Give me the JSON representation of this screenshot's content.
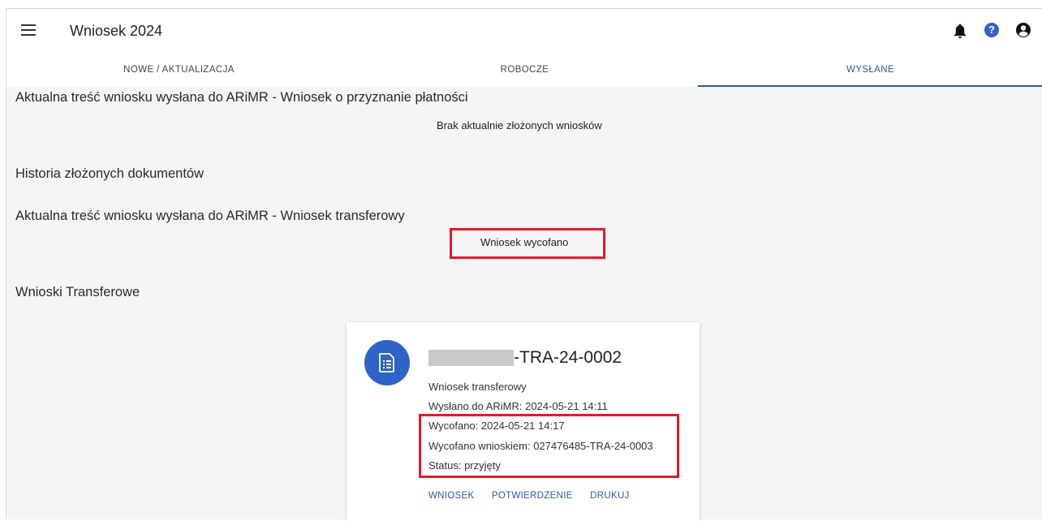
{
  "header": {
    "title": "Wniosek 2024",
    "icons": [
      "menu-icon",
      "bell-icon",
      "help-icon",
      "account-icon"
    ]
  },
  "tabs": [
    {
      "label": "NOWE / AKTUALIZACJA",
      "active": false
    },
    {
      "label": "ROBOCZE",
      "active": false
    },
    {
      "label": "WYSŁANE",
      "active": true
    }
  ],
  "sections": {
    "current_payment_title": "Aktualna treść wniosku wysłana do ARiMR - Wniosek o przyznanie płatności",
    "no_applications": "Brak aktualnie złożonych wniosków",
    "history_title": "Historia złożonych dokumentów",
    "current_transfer_title": "Aktualna treść wniosku wysłana do ARiMR - Wniosek transferowy",
    "withdrawn_text": "Wniosek wycofano",
    "transfer_list_title": "Wnioski Transferowe"
  },
  "card": {
    "number_suffix": "-TRA-24-0002",
    "type": "Wniosek transferowy",
    "sent": "Wysłano do ARiMR: 2024-05-21 14:11",
    "withdrawn": "Wycofano: 2024-05-21 14:17",
    "withdrawn_by": "Wycofano wnioskiem: 027476485-TRA-24-0003",
    "status": "Status: przyjęty",
    "actions": [
      "WNIOSEK",
      "POTWIERDZENIE",
      "DRUKUJ"
    ]
  },
  "colors": {
    "accent": "#2d58a8",
    "avatar": "#2f63c9",
    "highlight": "#e21b2a",
    "content_bg": "#f5f5f6"
  }
}
